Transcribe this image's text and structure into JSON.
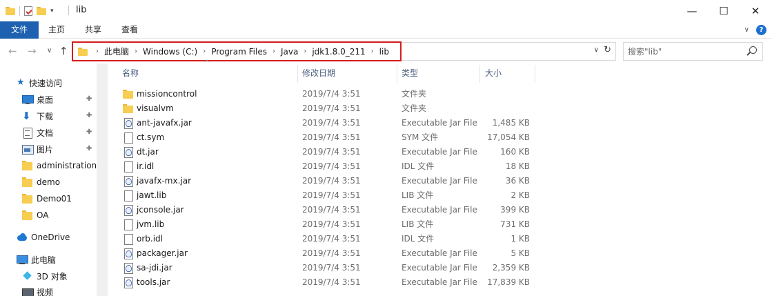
{
  "window": {
    "title": "lib",
    "minimize_glyph": "—",
    "maximize_glyph": "☐",
    "close_glyph": "✕"
  },
  "ribbon": {
    "tabs": [
      "文件",
      "主页",
      "共享",
      "查看"
    ],
    "expand_glyph": "∨",
    "help_glyph": "?"
  },
  "address": {
    "back_glyph": "←",
    "forward_glyph": "→",
    "recent_glyph": "∨",
    "up_glyph": "↑",
    "crumbs": [
      "此电脑",
      "Windows (C:)",
      "Program Files",
      "Java",
      "jdk1.8.0_211",
      "lib"
    ],
    "crumb_sep": "›",
    "dropdown_glyph": "∨",
    "refresh_glyph": "↻"
  },
  "search": {
    "placeholder": "搜索\"lib\""
  },
  "sidebar": {
    "items": [
      {
        "label": "快速访问",
        "icon": "star-icon",
        "pinned": false
      },
      {
        "label": "桌面",
        "icon": "desktop-icon",
        "pinned": true
      },
      {
        "label": "下载",
        "icon": "download-icon",
        "pinned": true
      },
      {
        "label": "文档",
        "icon": "document-icon",
        "pinned": true
      },
      {
        "label": "图片",
        "icon": "pictures-icon",
        "pinned": true
      },
      {
        "label": "administration",
        "icon": "folder-icon",
        "pinned": false
      },
      {
        "label": "demo",
        "icon": "folder-icon",
        "pinned": false
      },
      {
        "label": "Demo01",
        "icon": "folder-icon",
        "pinned": false
      },
      {
        "label": "OA",
        "icon": "folder-icon",
        "pinned": false
      },
      {
        "label": "OneDrive",
        "icon": "onedrive-icon",
        "pinned": false
      },
      {
        "label": "此电脑",
        "icon": "this-pc-icon",
        "pinned": false
      },
      {
        "label": "3D 对象",
        "icon": "3d-objects-icon",
        "pinned": false
      },
      {
        "label": "视频",
        "icon": "videos-icon",
        "pinned": false
      }
    ],
    "pin_glyph": "📌"
  },
  "columns": {
    "name": "名称",
    "date": "修改日期",
    "type": "类型",
    "size": "大小",
    "sort_glyph": "^"
  },
  "files": [
    {
      "name": "missioncontrol",
      "date": "2019/7/4 3:51",
      "type": "文件夹",
      "size": "",
      "kind": "folder"
    },
    {
      "name": "visualvm",
      "date": "2019/7/4 3:51",
      "type": "文件夹",
      "size": "",
      "kind": "folder"
    },
    {
      "name": "ant-javafx.jar",
      "date": "2019/7/4 3:51",
      "type": "Executable Jar File",
      "size": "1,485 KB",
      "kind": "jar"
    },
    {
      "name": "ct.sym",
      "date": "2019/7/4 3:51",
      "type": "SYM 文件",
      "size": "17,054 KB",
      "kind": "file"
    },
    {
      "name": "dt.jar",
      "date": "2019/7/4 3:51",
      "type": "Executable Jar File",
      "size": "160 KB",
      "kind": "jar"
    },
    {
      "name": "ir.idl",
      "date": "2019/7/4 3:51",
      "type": "IDL 文件",
      "size": "18 KB",
      "kind": "file"
    },
    {
      "name": "javafx-mx.jar",
      "date": "2019/7/4 3:51",
      "type": "Executable Jar File",
      "size": "36 KB",
      "kind": "jar"
    },
    {
      "name": "jawt.lib",
      "date": "2019/7/4 3:51",
      "type": "LIB 文件",
      "size": "2 KB",
      "kind": "file"
    },
    {
      "name": "jconsole.jar",
      "date": "2019/7/4 3:51",
      "type": "Executable Jar File",
      "size": "399 KB",
      "kind": "jar"
    },
    {
      "name": "jvm.lib",
      "date": "2019/7/4 3:51",
      "type": "LIB 文件",
      "size": "731 KB",
      "kind": "file"
    },
    {
      "name": "orb.idl",
      "date": "2019/7/4 3:51",
      "type": "IDL 文件",
      "size": "1 KB",
      "kind": "file"
    },
    {
      "name": "packager.jar",
      "date": "2019/7/4 3:51",
      "type": "Executable Jar File",
      "size": "5 KB",
      "kind": "jar"
    },
    {
      "name": "sa-jdi.jar",
      "date": "2019/7/4 3:51",
      "type": "Executable Jar File",
      "size": "2,359 KB",
      "kind": "jar"
    },
    {
      "name": "tools.jar",
      "date": "2019/7/4 3:51",
      "type": "Executable Jar File",
      "size": "17,839 KB",
      "kind": "jar"
    }
  ],
  "colors": {
    "accent": "#1e61b0",
    "highlight_border": "#d61b1b",
    "header_text": "#4d6082"
  }
}
